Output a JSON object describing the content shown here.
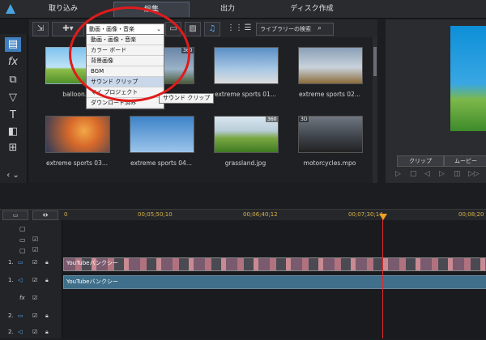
{
  "tabs": [
    {
      "label": "取り込み"
    },
    {
      "label": "編集"
    },
    {
      "label": "出力"
    },
    {
      "label": "ディスク作成"
    }
  ],
  "library": {
    "dropdown_value": "動画・画像・音楽",
    "dropdown_options": [
      "動画・画像・音楽",
      "カラー ボード",
      "背景画像",
      "BGM",
      "サウンド クリップ",
      "マイ プロジェクト",
      "ダウンロード済み"
    ],
    "tooltip": "サウンド クリップ",
    "search_placeholder": "ライブラリーの検索",
    "items": [
      {
        "label": "balloon.jpg",
        "badge": ""
      },
      {
        "label": "",
        "badge": "360"
      },
      {
        "label": "extreme sports 01...",
        "badge": ""
      },
      {
        "label": "extreme sports 02...",
        "badge": ""
      },
      {
        "label": "extreme sports 03...",
        "badge": ""
      },
      {
        "label": "extreme sports 04...",
        "badge": ""
      },
      {
        "label": "grassland.jpg",
        "badge": "360"
      },
      {
        "label": "motorcycles.mpo",
        "badge": "3D"
      }
    ]
  },
  "preview": {
    "clip_label": "クリップ",
    "movie_label": "ムービー"
  },
  "timeline": {
    "timecodes": [
      "0",
      "00;05;50;10",
      "00;06;40;12",
      "00;07;30;14",
      "00;08;20"
    ],
    "tracks": [
      {
        "label": "1."
      },
      {
        "label": "1."
      },
      {
        "label": "fx"
      },
      {
        "label": "2."
      },
      {
        "label": "2."
      }
    ],
    "video_clip_label": "YouTubeバンクシー",
    "audio_clip_label": "YouTubeバンクシー"
  },
  "colors": {
    "annotation": "#e01b1b",
    "playhead": "#e0292d",
    "timecode": "#d6b24a"
  }
}
